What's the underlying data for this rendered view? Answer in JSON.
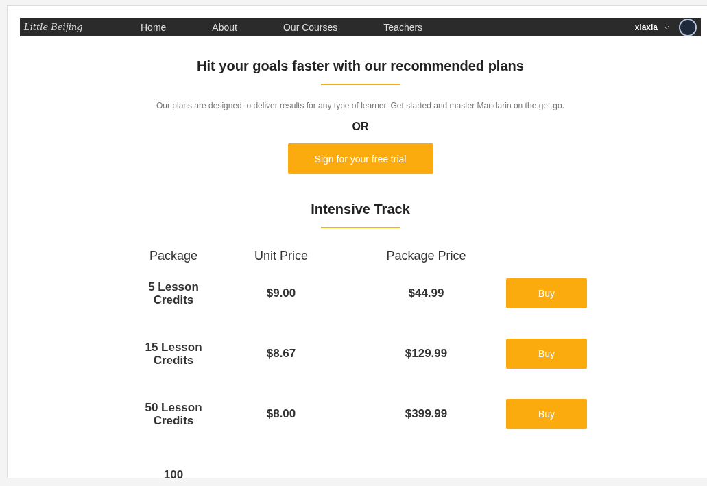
{
  "nav": {
    "logo": "Little Beijing",
    "links": [
      "Home",
      "About",
      "Our Courses",
      "Teachers"
    ],
    "user": "xiaxia"
  },
  "hero": {
    "title": "Hit your goals faster with our recommended plans",
    "subtitle": "Our plans are designed to deliver results for any type of learner. Get started and master Mandarin on the get-go.",
    "or": "OR",
    "trial_button": "Sign for your free trial"
  },
  "track": {
    "title": "Intensive Track",
    "columns": [
      "Package",
      "Unit Price",
      "Package Price"
    ],
    "rows": [
      {
        "package": "5 Lesson Credits",
        "unit_price": "$9.00",
        "package_price": "$44.99",
        "button": "Buy"
      },
      {
        "package": "15 Lesson Credits",
        "unit_price": "$8.67",
        "package_price": "$129.99",
        "button": "Buy"
      },
      {
        "package": "50 Lesson Credits",
        "unit_price": "$8.00",
        "package_price": "$399.99",
        "button": "Buy"
      },
      {
        "package": "100"
      }
    ]
  }
}
